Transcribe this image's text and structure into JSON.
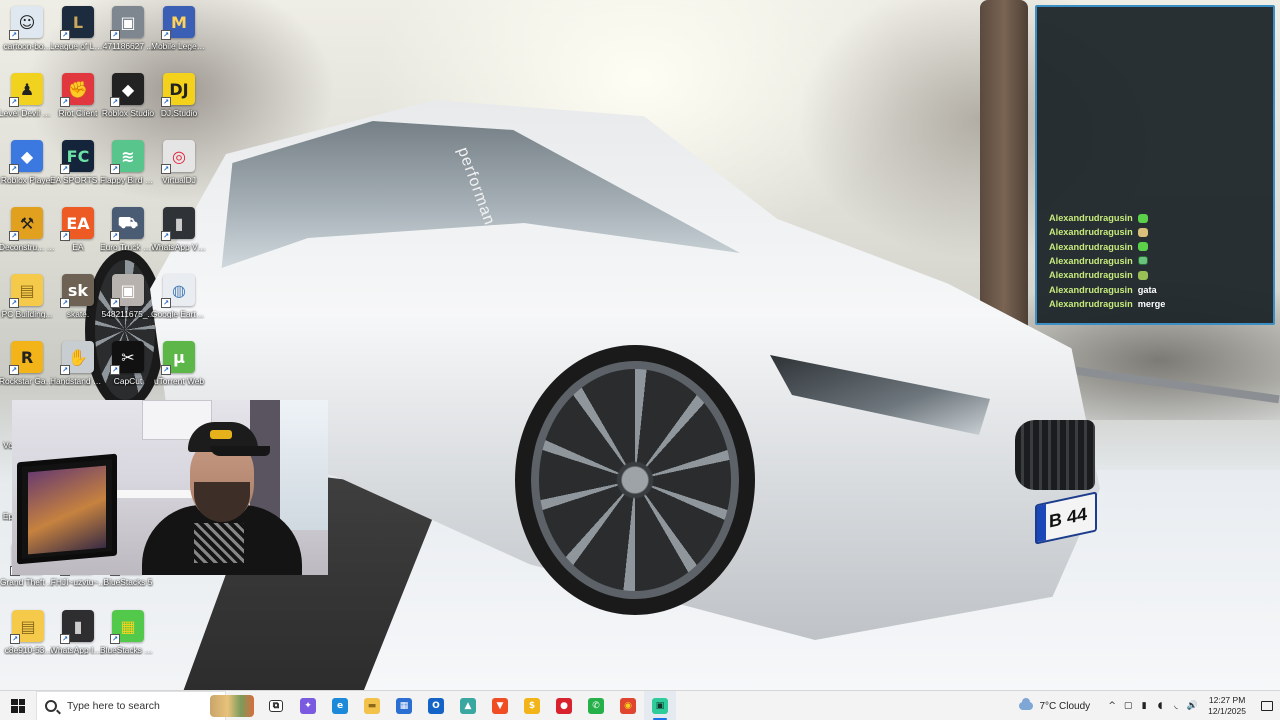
{
  "desktop": {
    "icons": [
      {
        "label": "cartoon-bo...",
        "glyph": "☺",
        "color": "#dfe8f1",
        "fg": "#222"
      },
      {
        "label": "League of Legends",
        "glyph": "L",
        "color": "#1c2b3d",
        "fg": "#c8a85a"
      },
      {
        "label": "471186627 ...",
        "glyph": "▣",
        "color": "#7e8790",
        "fg": "#fff"
      },
      {
        "label": "Mobile Legends B...",
        "glyph": "M",
        "color": "#3b5fb5",
        "fg": "#ffd25a"
      },
      {
        "label": "Level Devil Demo",
        "glyph": "♟",
        "color": "#f0d21f",
        "fg": "#222"
      },
      {
        "label": "Riot Client",
        "glyph": "✊",
        "color": "#e0383e",
        "fg": "#fff"
      },
      {
        "label": "Roblox Studio",
        "glyph": "◆",
        "color": "#222222",
        "fg": "#fff"
      },
      {
        "label": "DJ.Studio",
        "glyph": "DJ",
        "color": "#f4d21c",
        "fg": "#222"
      },
      {
        "label": "Roblox Player",
        "glyph": "◆",
        "color": "#3b79e0",
        "fg": "#fff"
      },
      {
        "label": "EA SPORTS FC™ 24",
        "glyph": "FC",
        "color": "#14243a",
        "fg": "#6ce1a6"
      },
      {
        "label": "Flappy Bird Playgama...",
        "glyph": "≋",
        "color": "#57c58c",
        "fg": "#fff"
      },
      {
        "label": "VirtualDJ",
        "glyph": "◎",
        "color": "#e5e5e5",
        "fg": "#e2223b"
      },
      {
        "label": "Deconstru... Simulator ...",
        "glyph": "⚒",
        "color": "#e1a11f",
        "fg": "#222"
      },
      {
        "label": "EA",
        "glyph": "EA",
        "color": "#ee5a24",
        "fg": "#fff"
      },
      {
        "label": "Euro Truck Simulator...",
        "glyph": "⛟",
        "color": "#4a5c74",
        "fg": "#fff"
      },
      {
        "label": "WhatsApp Video 2025-...",
        "glyph": "▮",
        "color": "#2f3237",
        "fg": "#ccc"
      },
      {
        "label": "PC Building...",
        "glyph": "▤",
        "color": "#f5c94a",
        "fg": "#8a6a1b"
      },
      {
        "label": "skate.",
        "glyph": "sk",
        "color": "#6e6254",
        "fg": "#fff"
      },
      {
        "label": "548211675_...",
        "glyph": "▣",
        "color": "#b7b2ad",
        "fg": "#fff"
      },
      {
        "label": "Google Earth Pro",
        "glyph": "◍",
        "color": "#e9edf1",
        "fg": "#4b7fb8"
      },
      {
        "label": "Rockstar Games ...",
        "glyph": "R",
        "color": "#f2b418",
        "fg": "#222"
      },
      {
        "label": "Handstand Hank",
        "glyph": "✋",
        "color": "#c7cdd1",
        "fg": "#333"
      },
      {
        "label": "CapCut",
        "glyph": "✂",
        "color": "#111111",
        "fg": "#fff"
      },
      {
        "label": "uTorrent Web",
        "glyph": "µ",
        "color": "#5cb748",
        "fg": "#fff"
      },
      {
        "label": "Vo",
        "glyph": "",
        "color": "#6a6a6a",
        "fg": "#fff"
      },
      {
        "label": "Ep",
        "glyph": "",
        "color": "#444444",
        "fg": "#fff"
      },
      {
        "label": "Grand Theft Auto V",
        "glyph": "V",
        "color": "#262626",
        "fg": "#fff"
      },
      {
        "label": "FHJI~uzvtu~...",
        "glyph": "▣",
        "color": "#8b5a3d",
        "fg": "#fff"
      },
      {
        "label": "BlueStacks 5",
        "glyph": "▦",
        "color": "#45c93f",
        "fg": "#fff"
      },
      {
        "label": "c8e910-53...",
        "glyph": "▤",
        "color": "#f5c94a",
        "fg": "#8a6a1b"
      },
      {
        "label": "WhatsApp Image 2025-...",
        "glyph": "▮",
        "color": "#2e2e30",
        "fg": "#ccc"
      },
      {
        "label": "BlueStacks Multi-Insta...",
        "glyph": "▦",
        "color": "#52c94a",
        "fg": "#f4d21c"
      }
    ]
  },
  "wallpaper": {
    "car_text": "performance",
    "plate_text": "B 44"
  },
  "chat": {
    "messages": [
      {
        "user": "Alexandrudragusin",
        "text": "",
        "emote": "green"
      },
      {
        "user": "Alexandrudragusin",
        "text": "",
        "emote": "face"
      },
      {
        "user": "Alexandrudragusin",
        "text": "",
        "emote": "green"
      },
      {
        "user": "Alexandrudragusin",
        "text": "",
        "emote": "monitor"
      },
      {
        "user": "Alexandrudragusin",
        "text": "",
        "emote": "globe"
      },
      {
        "user": "Alexandrudragusin",
        "text": "gata",
        "emote": ""
      },
      {
        "user": "Alexandrudragusin",
        "text": "merge",
        "emote": ""
      }
    ]
  },
  "taskbar": {
    "search_placeholder": "Type here to search",
    "apps": [
      {
        "name": "task-view",
        "glyph": "⧉",
        "color": "#ffffff",
        "fg": "#222",
        "active": false
      },
      {
        "name": "copilot",
        "glyph": "✦",
        "color": "#7a5ae0",
        "fg": "#fff",
        "active": false
      },
      {
        "name": "edge",
        "glyph": "e",
        "color": "#1c8ad8",
        "fg": "#fff",
        "active": false
      },
      {
        "name": "file-explorer",
        "glyph": "▬",
        "color": "#f3c24a",
        "fg": "#8a6a1b",
        "active": false
      },
      {
        "name": "store",
        "glyph": "▦",
        "color": "#2a6fd1",
        "fg": "#fff",
        "active": false
      },
      {
        "name": "outlook",
        "glyph": "O",
        "color": "#1464c8",
        "fg": "#fff",
        "active": false
      },
      {
        "name": "photos",
        "glyph": "▲",
        "color": "#3aa7a0",
        "fg": "#fff",
        "active": false
      },
      {
        "name": "brave",
        "glyph": "▼",
        "color": "#f04d23",
        "fg": "#fff",
        "active": false
      },
      {
        "name": "game-app",
        "glyph": "$",
        "color": "#f2b418",
        "fg": "#fff",
        "active": false
      },
      {
        "name": "record-app",
        "glyph": "●",
        "color": "#d8232f",
        "fg": "#fff",
        "active": false
      },
      {
        "name": "whatsapp",
        "glyph": "✆",
        "color": "#25b04a",
        "fg": "#fff",
        "active": false
      },
      {
        "name": "chrome",
        "glyph": "◉",
        "color": "#e0452f",
        "fg": "#f4d21c",
        "active": false
      },
      {
        "name": "streamlabs",
        "glyph": "▣",
        "color": "#2ecc9a",
        "fg": "#11332a",
        "active": true
      }
    ],
    "weather": "7°C  Cloudy",
    "tray_icons": [
      "^",
      "▢",
      "▮",
      "◖",
      "◟",
      "🔊"
    ],
    "time": "12:27 PM",
    "date": "12/1/2025"
  }
}
